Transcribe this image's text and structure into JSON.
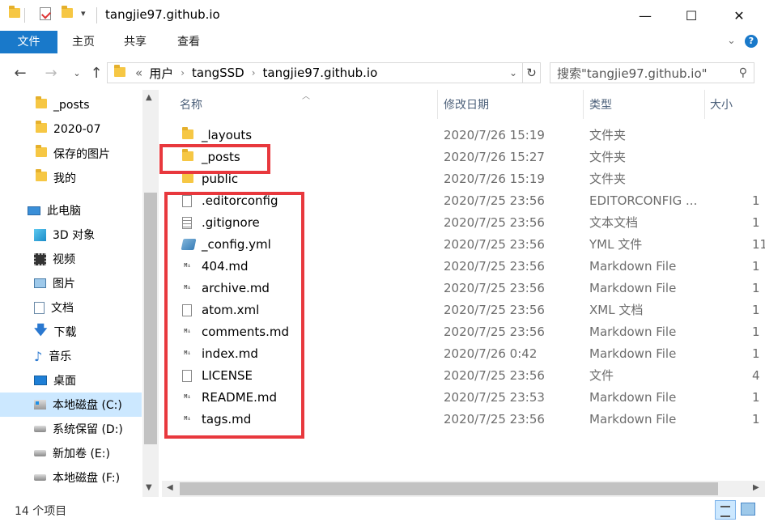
{
  "window": {
    "title": "tangjie97.github.io",
    "controls": {
      "minimize": "—",
      "maximize": "☐",
      "close": "✕"
    }
  },
  "ribbon": {
    "tabs": [
      "文件",
      "主页",
      "共享",
      "查看"
    ],
    "accent": "#1979ca"
  },
  "address": {
    "prefix": "«",
    "breadcrumbs": [
      "用户",
      "tangSSD",
      "tangjie97.github.io"
    ],
    "search_placeholder": "搜索\"tangjie97.github.io\""
  },
  "nav_pane": {
    "quick_access": [
      "_posts",
      "2020-07",
      "保存的图片",
      "我的"
    ],
    "this_pc": "此电脑",
    "pc_items": [
      {
        "label": "3D 对象",
        "icon": "3d-objects-icon"
      },
      {
        "label": "视频",
        "icon": "video-icon"
      },
      {
        "label": "图片",
        "icon": "pictures-icon"
      },
      {
        "label": "文档",
        "icon": "documents-icon"
      },
      {
        "label": "下载",
        "icon": "download-icon"
      },
      {
        "label": "音乐",
        "icon": "music-icon"
      },
      {
        "label": "桌面",
        "icon": "desktop-icon"
      },
      {
        "label": "本地磁盘 (C:)",
        "icon": "drive-c-icon",
        "selected": true
      },
      {
        "label": "系统保留 (D:)",
        "icon": "drive-icon"
      },
      {
        "label": "新加卷 (E:)",
        "icon": "drive-icon"
      },
      {
        "label": "本地磁盘 (F:)",
        "icon": "drive-icon"
      }
    ]
  },
  "columns": {
    "name": "名称",
    "date": "修改日期",
    "type": "类型",
    "size": "大小"
  },
  "files": [
    {
      "name": "_layouts",
      "date": "2020/7/26 15:19",
      "type": "文件夹",
      "size": "",
      "icon": "folder"
    },
    {
      "name": "_posts",
      "date": "2020/7/26 15:27",
      "type": "文件夹",
      "size": "",
      "icon": "folder"
    },
    {
      "name": "public",
      "date": "2020/7/26 15:19",
      "type": "文件夹",
      "size": "",
      "icon": "folder"
    },
    {
      "name": ".editorconfig",
      "date": "2020/7/25 23:56",
      "type": "EDITORCONFIG ...",
      "size": "1",
      "icon": "doc"
    },
    {
      "name": ".gitignore",
      "date": "2020/7/25 23:56",
      "type": "文本文档",
      "size": "1",
      "icon": "text"
    },
    {
      "name": "_config.yml",
      "date": "2020/7/25 23:56",
      "type": "YML 文件",
      "size": "11",
      "icon": "yml"
    },
    {
      "name": "404.md",
      "date": "2020/7/25 23:56",
      "type": "Markdown File",
      "size": "1",
      "icon": "md"
    },
    {
      "name": "archive.md",
      "date": "2020/7/25 23:56",
      "type": "Markdown File",
      "size": "1",
      "icon": "md"
    },
    {
      "name": "atom.xml",
      "date": "2020/7/25 23:56",
      "type": "XML 文档",
      "size": "1",
      "icon": "doc"
    },
    {
      "name": "comments.md",
      "date": "2020/7/25 23:56",
      "type": "Markdown File",
      "size": "1",
      "icon": "md"
    },
    {
      "name": "index.md",
      "date": "2020/7/26 0:42",
      "type": "Markdown File",
      "size": "1",
      "icon": "md"
    },
    {
      "name": "LICENSE",
      "date": "2020/7/25 23:56",
      "type": "文件",
      "size": "4",
      "icon": "doc"
    },
    {
      "name": "README.md",
      "date": "2020/7/25 23:53",
      "type": "Markdown File",
      "size": "1",
      "icon": "md"
    },
    {
      "name": "tags.md",
      "date": "2020/7/25 23:56",
      "type": "Markdown File",
      "size": "1",
      "icon": "md"
    }
  ],
  "status": {
    "item_count": "14 个项目"
  },
  "highlight_color": "#e8383d"
}
